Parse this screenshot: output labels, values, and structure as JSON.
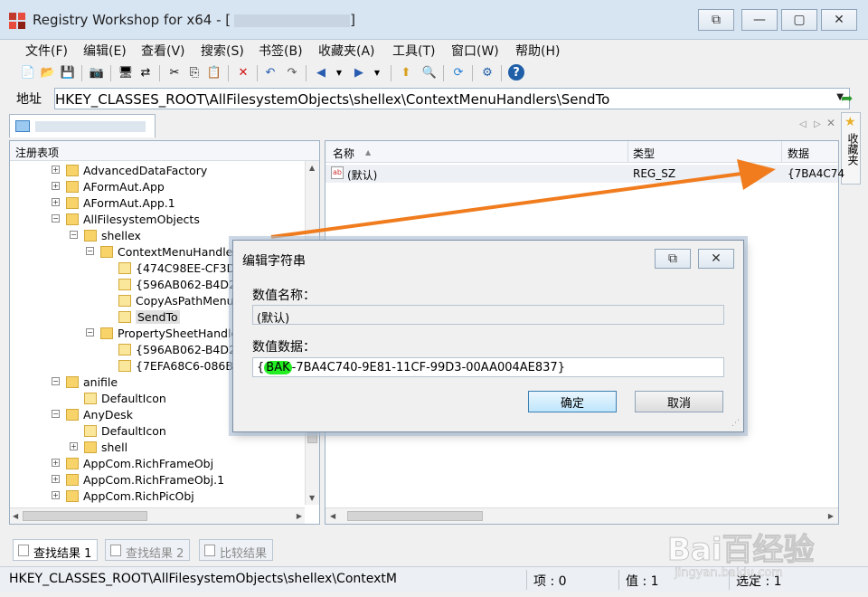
{
  "window": {
    "title": "Registry Workshop for x64 - [",
    "title_suffix": "]"
  },
  "menu": [
    "文件(F)",
    "编辑(E)",
    "查看(V)",
    "搜索(S)",
    "书签(B)",
    "收藏夹(A)",
    "工具(T)",
    "窗口(W)",
    "帮助(H)"
  ],
  "address": {
    "label": "地址",
    "value": "HKEY_CLASSES_ROOT\\AllFilesystemObjects\\shellex\\ContextMenuHandlers\\SendTo"
  },
  "favorites": {
    "label": "收藏夹"
  },
  "tree": {
    "header": "注册表项",
    "rows": [
      {
        "label": "AdvancedDataFactory",
        "expander": "+"
      },
      {
        "label": "AFormAut.App",
        "expander": "+"
      },
      {
        "label": "AFormAut.App.1",
        "expander": "+"
      },
      {
        "label": "AllFilesystemObjects",
        "expander": "−"
      },
      {
        "label": "shellex",
        "expander": "−"
      },
      {
        "label": "ContextMenuHandlers",
        "expander": "−"
      },
      {
        "label": "{474C98EE-CF3D-4",
        "expander": ""
      },
      {
        "label": "{596AB062-B4D2-4",
        "expander": ""
      },
      {
        "label": "CopyAsPathMenu",
        "expander": ""
      },
      {
        "label": "SendTo",
        "expander": "",
        "selected": true
      },
      {
        "label": "PropertySheetHandler",
        "expander": "−"
      },
      {
        "label": "{596AB062-B4D2-4",
        "expander": ""
      },
      {
        "label": "{7EFA68C6-086B-4",
        "expander": ""
      },
      {
        "label": "anifile",
        "expander": "−"
      },
      {
        "label": "DefaultIcon",
        "expander": ""
      },
      {
        "label": "AnyDesk",
        "expander": "−"
      },
      {
        "label": "DefaultIcon",
        "expander": ""
      },
      {
        "label": "shell",
        "expander": "+"
      },
      {
        "label": "AppCom.RichFrameObj",
        "expander": "+"
      },
      {
        "label": "AppCom.RichFrameObj.1",
        "expander": "+"
      },
      {
        "label": "AppCom.RichPicObj",
        "expander": "+"
      }
    ]
  },
  "list": {
    "columns": {
      "name": "名称",
      "type": "类型",
      "data": "数据"
    },
    "rows": [
      {
        "name": "(默认)",
        "type": "REG_SZ",
        "data": "{7BA4C74"
      }
    ]
  },
  "dialog": {
    "title": "编辑字符串",
    "name_label": "数值名称：",
    "name_value": "(默认)",
    "data_label": "数值数据：",
    "data_prefix": "{",
    "data_highlight": "BAK",
    "data_rest": "-7BA4C740-9E81-11CF-99D3-00AA004AE837}",
    "ok": "确定",
    "cancel": "取消"
  },
  "bottom_tabs": [
    "查找结果 1",
    "查找结果 2",
    "比较结果"
  ],
  "status": {
    "path": "HKEY_CLASSES_ROOT\\AllFilesystemObjects\\shellex\\ContextM",
    "items": "项 : 0",
    "values": "值 : 1",
    "selected": "选定 : 1"
  },
  "watermark": {
    "brand": "Bai百经验",
    "url": "jingyan.baidu.com"
  },
  "colors": {
    "annotation_arrow": "#f07c1e",
    "highlight": "#22ee22",
    "titlebar": "#d7e4f2"
  }
}
